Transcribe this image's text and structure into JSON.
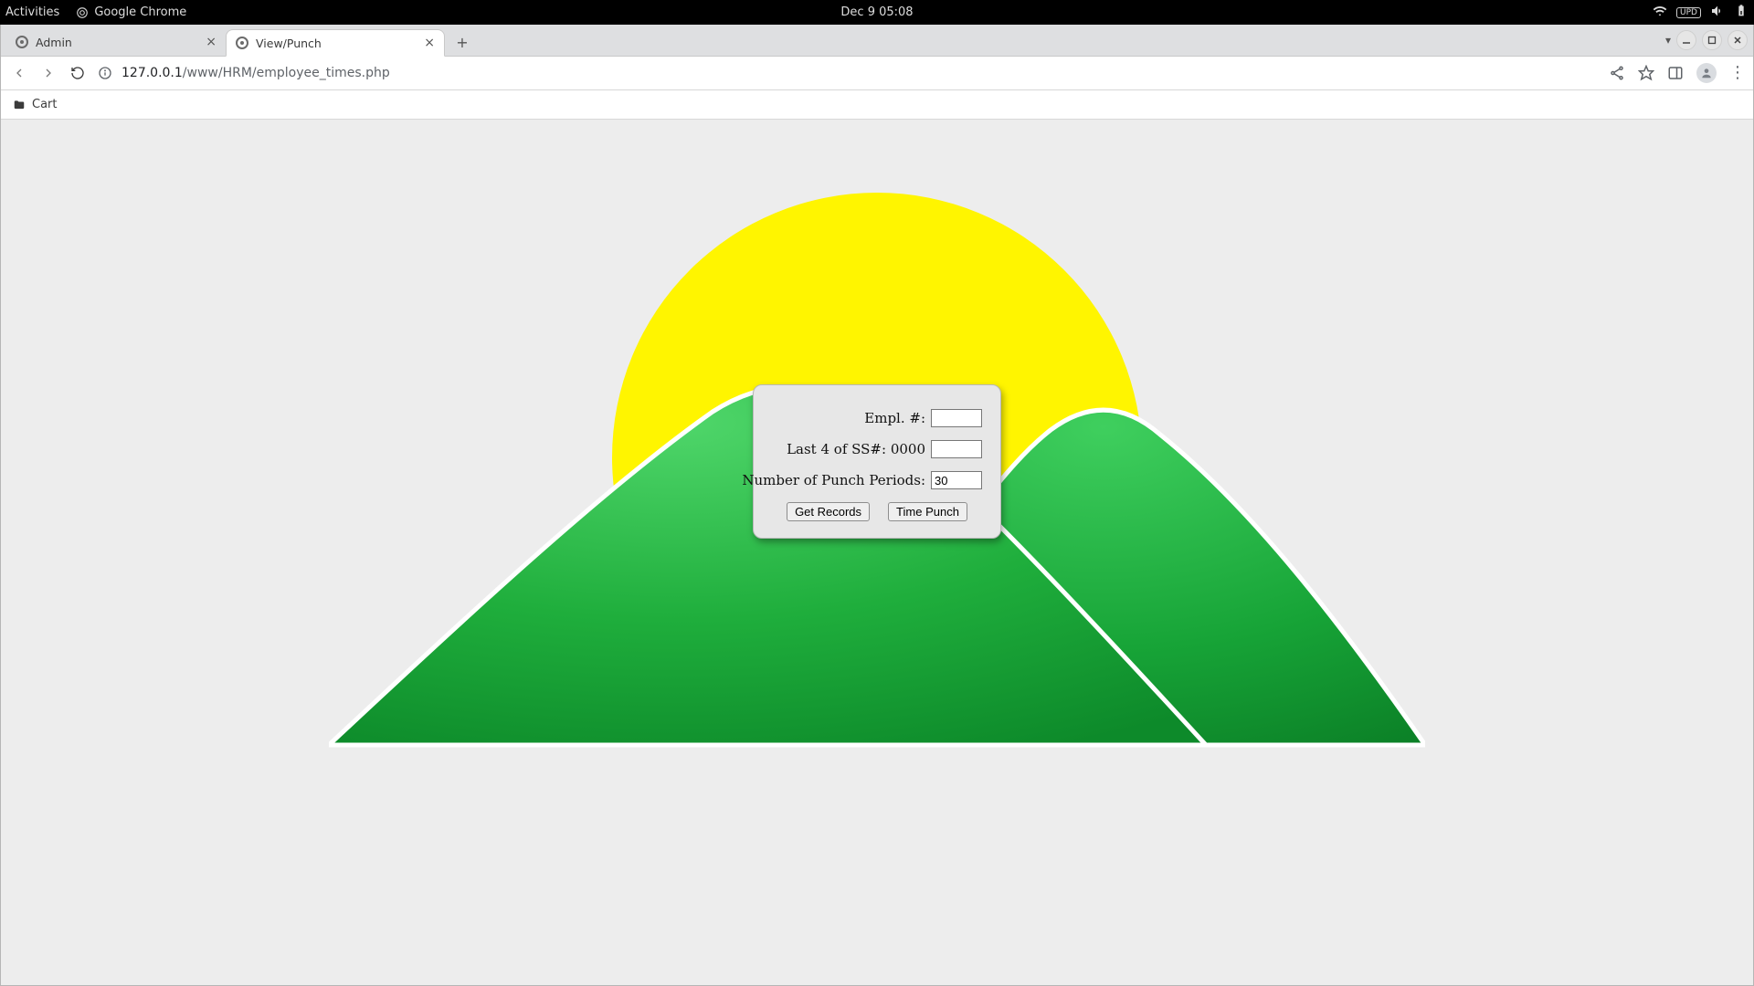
{
  "os": {
    "activities": "Activities",
    "app_name": "Google Chrome",
    "clock": "Dec 9  05:08"
  },
  "chrome": {
    "tabs": [
      {
        "title": "Admin",
        "active": false
      },
      {
        "title": "View/Punch",
        "active": true
      }
    ],
    "url_host": "127.0.0.1",
    "url_path": "/www/HRM/employee_times.php",
    "bookmarks": [
      {
        "label": "Cart"
      }
    ]
  },
  "form": {
    "empl_label": "Empl. #:",
    "empl_value": "",
    "ssn_label": "Last 4 of SS#: 0000",
    "ssn_value": "",
    "periods_label": "Number of Punch Periods:",
    "periods_value": "30",
    "get_records_label": "Get Records",
    "time_punch_label": "Time Punch"
  }
}
